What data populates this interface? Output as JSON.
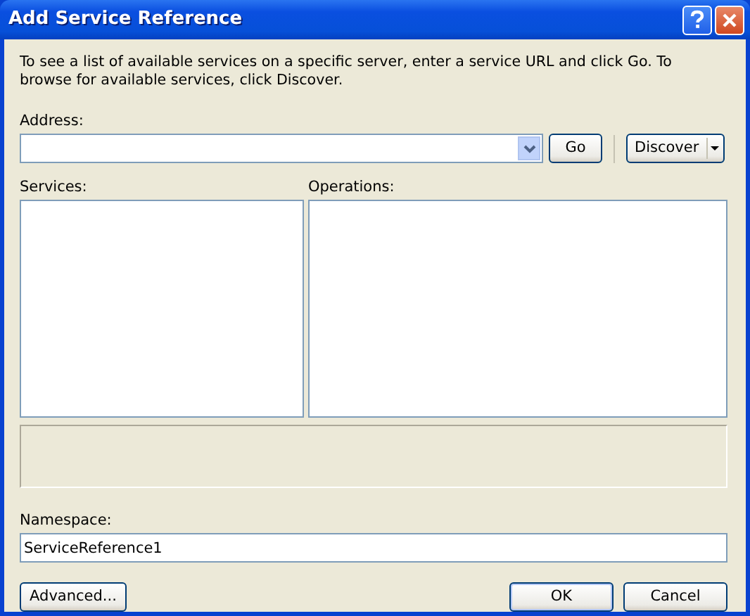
{
  "window": {
    "title": "Add Service Reference"
  },
  "instructions": "To see a list of available services on a specific server, enter a service URL and click Go. To browse for available services, click Discover.",
  "address": {
    "label": "Address:"
  },
  "go_button": "Go",
  "discover_button": "Discover",
  "services": {
    "label": "Services:"
  },
  "operations": {
    "label": "Operations:"
  },
  "namespace": {
    "label": "Namespace:",
    "value": "ServiceReference1"
  },
  "advanced_button": "Advanced...",
  "buttons": [
    "OK",
    "Cancel"
  ]
}
